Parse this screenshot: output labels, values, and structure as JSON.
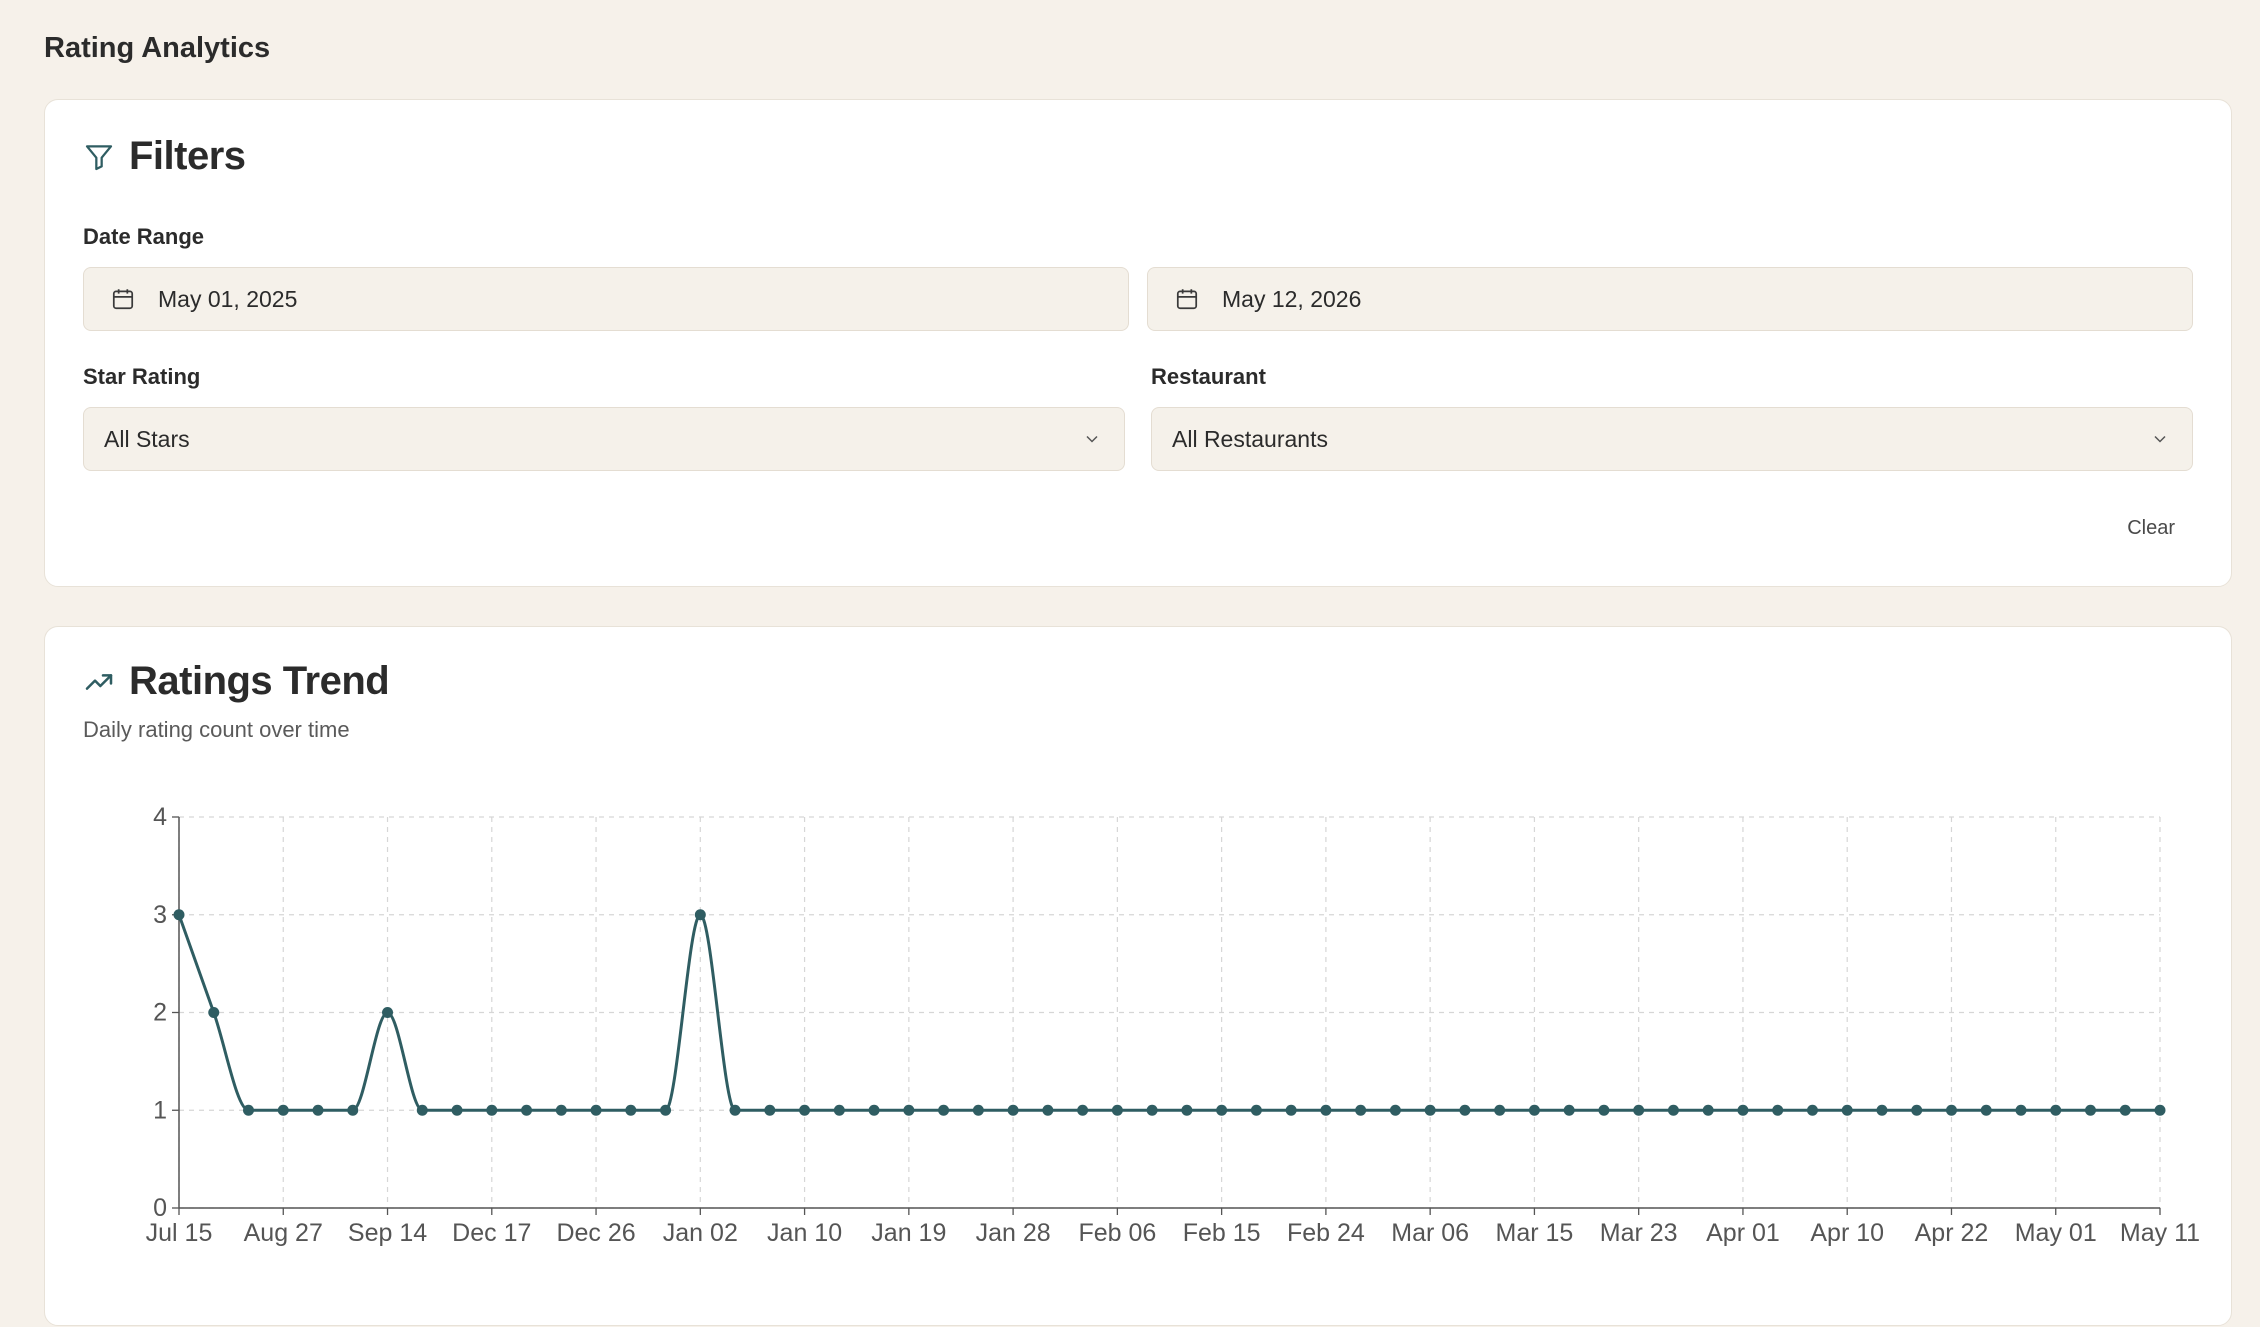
{
  "page": {
    "title": "Rating Analytics"
  },
  "filters": {
    "title": "Filters",
    "date_range_label": "Date Range",
    "start_date": "May 01, 2025",
    "end_date": "May 12, 2026",
    "star_rating_label": "Star Rating",
    "star_rating_value": "All Stars",
    "restaurant_label": "Restaurant",
    "restaurant_value": "All Restaurants",
    "clear_label": "Clear"
  },
  "trend": {
    "title": "Ratings Trend",
    "subtitle": "Daily rating count over time"
  },
  "colors": {
    "accent": "#2f5d62",
    "background": "#f6f1ea",
    "grid": "#d6d6d6"
  },
  "chart_data": {
    "type": "line",
    "title": "",
    "xlabel": "",
    "ylabel": "",
    "ylim": [
      0,
      4
    ],
    "yticks": [
      0,
      1,
      2,
      3,
      4
    ],
    "grid": true,
    "legend": "none",
    "x_tick_labels": [
      "Jul 15",
      "Aug 27",
      "Sep 14",
      "Dec 17",
      "Dec 26",
      "Jan 02",
      "Jan 10",
      "Jan 19",
      "Jan 28",
      "Feb 06",
      "Feb 15",
      "Feb 24",
      "Mar 06",
      "Mar 15",
      "Mar 23",
      "Apr 01",
      "Apr 10",
      "Apr 22",
      "May 01",
      "May 11"
    ],
    "series": [
      {
        "values": [
          3,
          2,
          1,
          1,
          1,
          1,
          2,
          1,
          1,
          1,
          1,
          1,
          1,
          1,
          1,
          3,
          1,
          1,
          1,
          1,
          1,
          1,
          1,
          1,
          1,
          1,
          1,
          1,
          1,
          1,
          1,
          1,
          1,
          1,
          1,
          1,
          1,
          1,
          1,
          1,
          1,
          1,
          1,
          1,
          1,
          1,
          1,
          1,
          1,
          1,
          1,
          1,
          1,
          1,
          1,
          1,
          1,
          1
        ]
      }
    ]
  }
}
